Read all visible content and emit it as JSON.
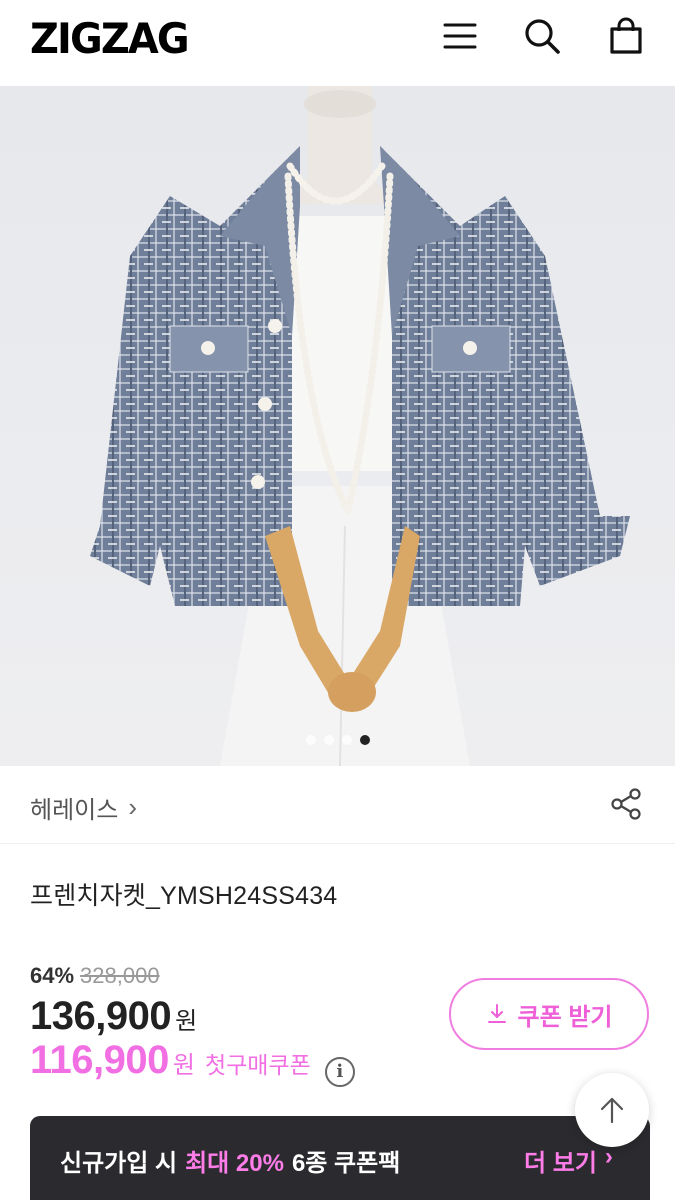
{
  "header": {
    "logo": "ZIGZAG",
    "menu_icon": "hamburger-menu-icon",
    "search_icon": "search-icon",
    "cart_icon": "shopping-bag-icon"
  },
  "gallery": {
    "image_count": 4,
    "active_index": 3
  },
  "brand": {
    "name": "헤레이스",
    "chevron": "›",
    "share_icon": "share-icon"
  },
  "product": {
    "title": "프렌치자켓_YMSH24SS434"
  },
  "price": {
    "discount_rate": "64%",
    "original": "328,000",
    "sale": "136,900",
    "won": "원",
    "coupon_price": "116,900",
    "coupon_won": "원",
    "coupon_label": "첫구매쿠폰",
    "info_icon": "i"
  },
  "coupon_button": {
    "label": "쿠폰 받기",
    "icon": "download-icon"
  },
  "banner": {
    "text_prefix": "신규가입 시",
    "highlight": "최대 20%",
    "text_suffix": "6종 쿠폰팩",
    "more": "더 보기",
    "more_chevron": "›"
  },
  "colors": {
    "accent_pink": "#f26ee3",
    "banner_bg": "#2b2b2f"
  }
}
